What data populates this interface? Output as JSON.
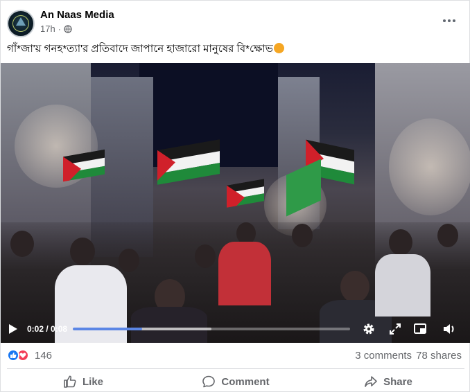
{
  "post": {
    "page_name": "An Naas Media",
    "time": "17h",
    "privacy_icon": "globe-icon",
    "text": "গাঁ*জা'য় গনহ*ত্যা'র প্রতিবাদে জাপানে হাজারো মানুষের বি*ক্ষোভ",
    "emoji": "raised-fist-emoji"
  },
  "video": {
    "current_time": "0:02",
    "duration": "0:08",
    "time_display": "0:02 / 0:08",
    "progress": 0.25,
    "buffered": 0.5,
    "accent_color": "#5b86e5",
    "icons": [
      "play-icon",
      "settings-gear-icon",
      "fullscreen-icon",
      "picture-in-picture-icon",
      "volume-icon"
    ]
  },
  "stats": {
    "reaction_count": "146",
    "reaction_icons": [
      "like-reaction-icon",
      "love-reaction-icon"
    ],
    "comments": "3 comments",
    "shares": "78 shares"
  },
  "actions": {
    "like": "Like",
    "comment": "Comment",
    "share": "Share"
  },
  "colors": {
    "like_blue": "#1877f2",
    "love_red": "#f33e58",
    "secondary_text": "#65676b"
  }
}
